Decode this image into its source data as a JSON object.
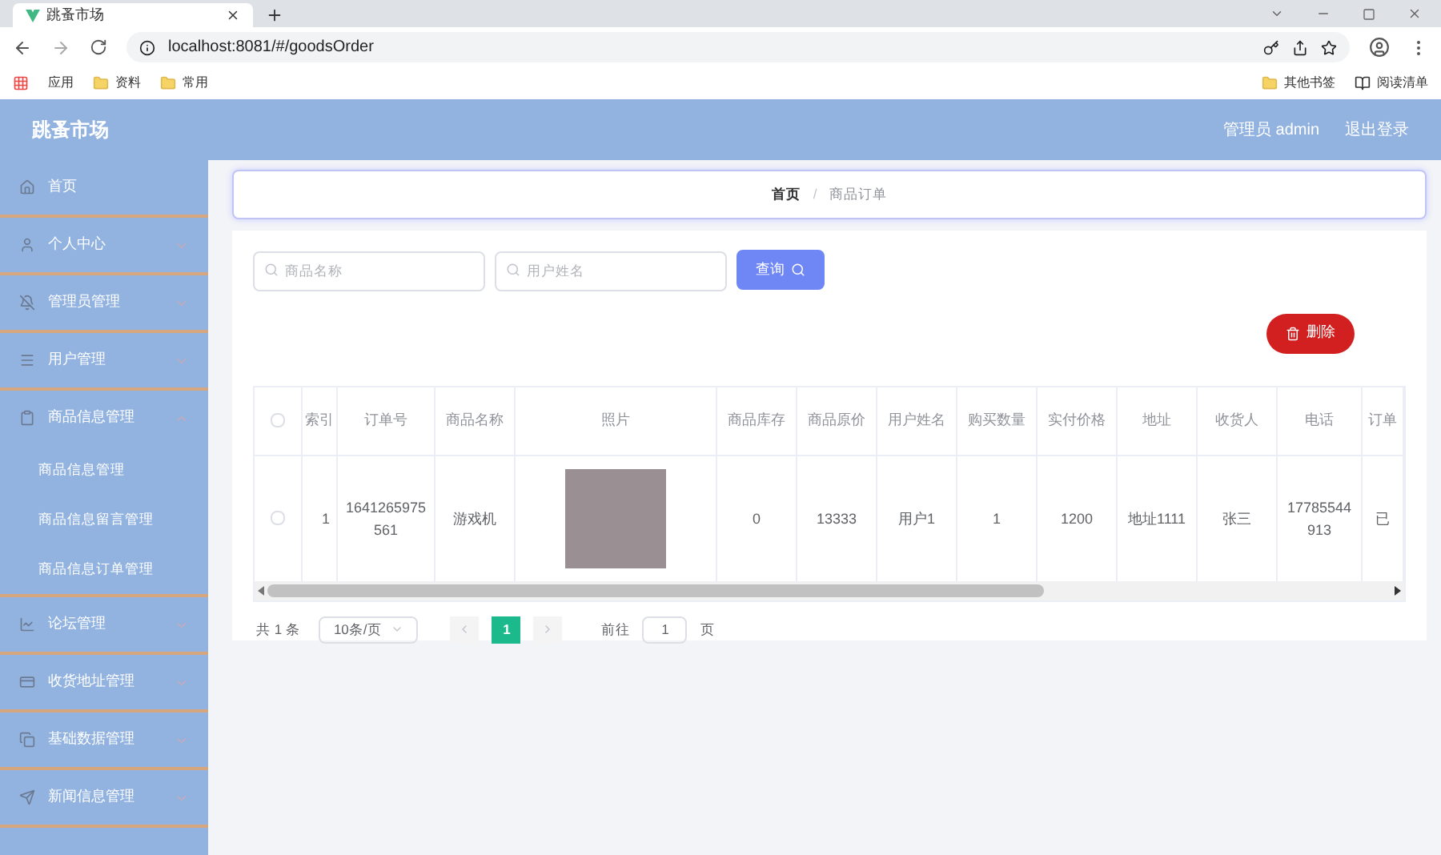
{
  "browser": {
    "tab_title": "跳蚤市场",
    "url": "localhost:8081/#/goodsOrder",
    "bookmarks": [
      "应用",
      "资料",
      "常用"
    ],
    "bookmarks_right": [
      "其他书签",
      "阅读清单"
    ]
  },
  "header": {
    "title": "跳蚤市场",
    "user": "管理员 admin",
    "logout": "退出登录"
  },
  "sidebar": {
    "items": [
      {
        "label": "首页",
        "kind": "link"
      },
      {
        "label": "个人中心",
        "kind": "group",
        "expanded": false
      },
      {
        "label": "管理员管理",
        "kind": "group",
        "expanded": false
      },
      {
        "label": "用户管理",
        "kind": "group",
        "expanded": false
      },
      {
        "label": "商品信息管理",
        "kind": "group",
        "expanded": true,
        "children": [
          "商品信息管理",
          "商品信息留言管理",
          "商品信息订单管理"
        ]
      },
      {
        "label": "论坛管理",
        "kind": "group",
        "expanded": false
      },
      {
        "label": "收货地址管理",
        "kind": "group",
        "expanded": false
      },
      {
        "label": "基础数据管理",
        "kind": "group",
        "expanded": false
      },
      {
        "label": "新闻信息管理",
        "kind": "group",
        "expanded": false
      }
    ]
  },
  "breadcrumb": [
    "首页",
    "商品订单"
  ],
  "breadcrumb_separator": "/",
  "search": {
    "fields": [
      {
        "placeholder": "商品名称"
      },
      {
        "placeholder": "用户姓名"
      }
    ],
    "button": "查询"
  },
  "delete_button": "删除",
  "table": {
    "select_all": {
      "checked": false
    },
    "columns": [
      {
        "kind": "text",
        "label": "索引"
      },
      {
        "kind": "text",
        "label": "订单号"
      },
      {
        "kind": "text",
        "label": "商品名称"
      },
      {
        "kind": "photo",
        "label": "照片"
      },
      {
        "kind": "text",
        "label": "商品库存"
      },
      {
        "kind": "text",
        "label": "商品原价"
      },
      {
        "kind": "text",
        "label": "用户姓名"
      },
      {
        "kind": "text",
        "label": "购买数量"
      },
      {
        "kind": "text",
        "label": "实付价格"
      },
      {
        "kind": "text",
        "label": "地址"
      },
      {
        "kind": "text",
        "label": "收货人"
      },
      {
        "kind": "text",
        "label": "电话"
      },
      {
        "kind": "text",
        "label": "订单"
      }
    ],
    "rows": [
      {
        "checked": false,
        "cells": [
          "1",
          "1641265975561",
          "游戏机",
          "",
          "0",
          "13333",
          "用户1",
          "1",
          "1200",
          "地址1111",
          "张三",
          "17785544913",
          "已"
        ]
      }
    ]
  },
  "pagination": {
    "total": "共 1 条",
    "page_size": "10条/页",
    "pages": [
      {
        "label": "1",
        "selected": true
      }
    ],
    "goto_label": "前往",
    "goto_value": "1",
    "goto_suffix": "页"
  }
}
